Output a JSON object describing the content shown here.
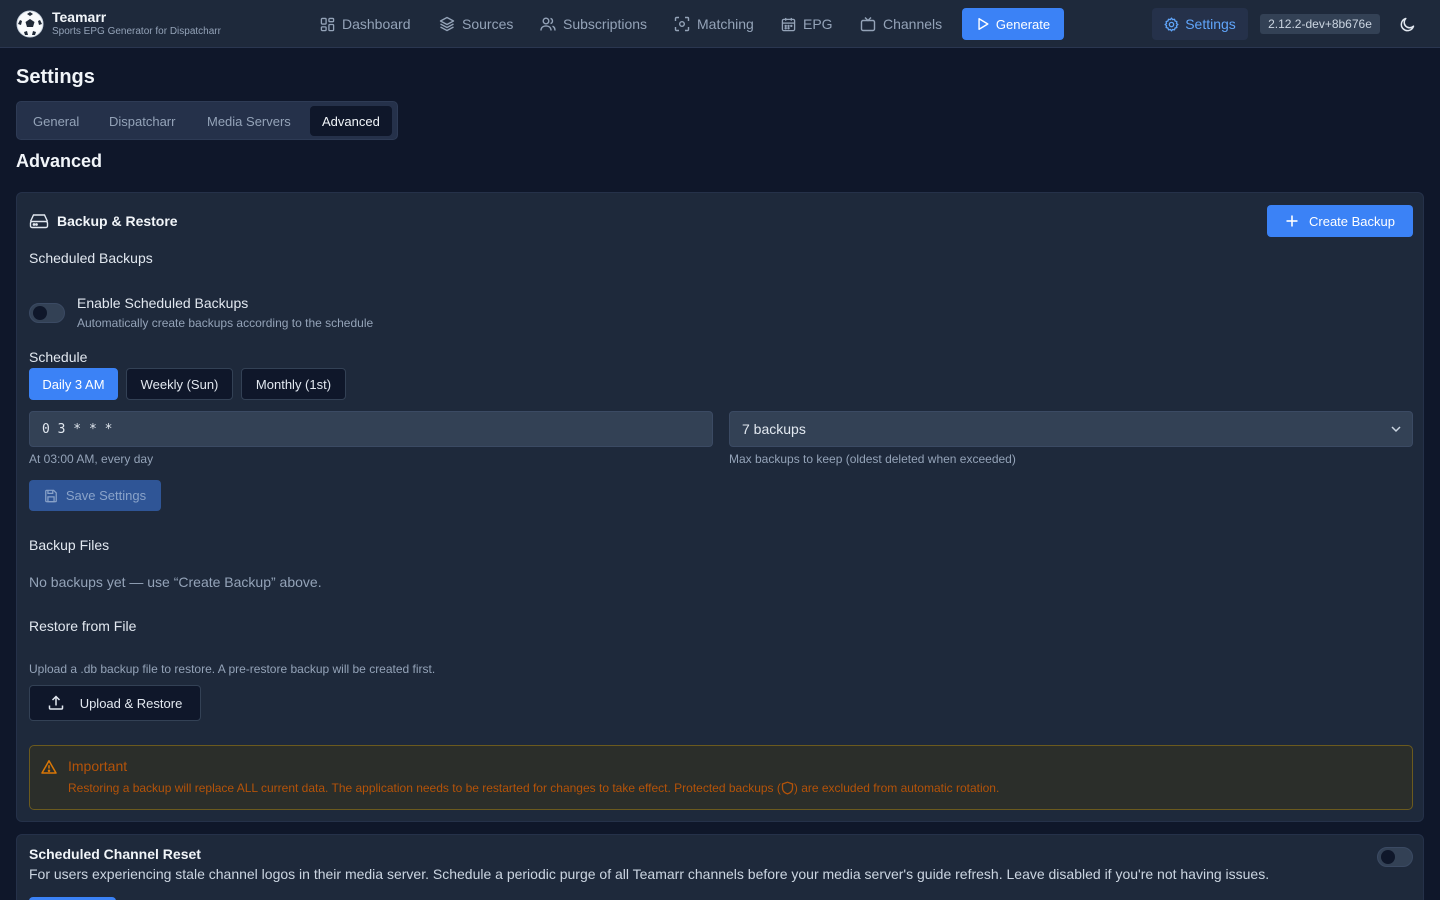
{
  "app": {
    "title": "Teamarr",
    "subtitle": "Sports EPG Generator for Dispatcharr",
    "version": "2.12.2-dev+8b676e"
  },
  "nav": {
    "items": [
      {
        "label": "Dashboard",
        "icon": "dashboard-icon"
      },
      {
        "label": "Sources",
        "icon": "layers-icon"
      },
      {
        "label": "Subscriptions",
        "icon": "users-icon"
      },
      {
        "label": "Matching",
        "icon": "scan-icon"
      },
      {
        "label": "EPG",
        "icon": "calendar-icon"
      },
      {
        "label": "Channels",
        "icon": "tv-icon"
      }
    ],
    "generate_label": "Generate",
    "settings_label": "Settings"
  },
  "page": {
    "title": "Settings",
    "tabs": [
      {
        "label": "General",
        "active": false
      },
      {
        "label": "Dispatcharr",
        "active": false
      },
      {
        "label": "Media Servers",
        "active": false
      },
      {
        "label": "Advanced",
        "active": true
      }
    ],
    "section_title": "Advanced"
  },
  "backup": {
    "title": "Backup & Restore",
    "create_label": "Create Backup",
    "scheduled_title": "Scheduled Backups",
    "enable_label": "Enable Scheduled Backups",
    "enable_desc": "Automatically create backups according to the schedule",
    "enabled": false,
    "schedule_label": "Schedule",
    "presets": [
      {
        "label": "Daily 3 AM",
        "active": true
      },
      {
        "label": "Weekly (Sun)",
        "active": false
      },
      {
        "label": "Monthly (1st)",
        "active": false
      }
    ],
    "cron_value": "0 3 * * *",
    "cron_help": "At 03:00 AM, every day",
    "retention_value": "7 backups",
    "retention_help": "Max backups to keep (oldest deleted when exceeded)",
    "save_label": "Save Settings",
    "files_title": "Backup Files",
    "files_empty": "No backups yet — use “Create Backup” above.",
    "restore_title": "Restore from File",
    "restore_desc": "Upload a .db backup file to restore. A pre-restore backup will be created first.",
    "upload_label": "Upload & Restore",
    "warning_title": "Important",
    "warning_text_1": "Restoring a backup will replace ALL current data. The application needs to be restarted for changes to take effect. Protected backups (",
    "warning_text_2": ") are excluded from automatic rotation."
  },
  "channel_reset": {
    "title": "Scheduled Channel Reset",
    "desc": "For users experiencing stale channel logos in their media server. Schedule a periodic purge of all Teamarr channels before your media server's guide refresh. Leave disabled if you're not having issues.",
    "enabled": false
  },
  "colors": {
    "accent": "#3b82f6",
    "background": "#0f172a",
    "card": "#1e293b",
    "warning": "#b45309"
  }
}
